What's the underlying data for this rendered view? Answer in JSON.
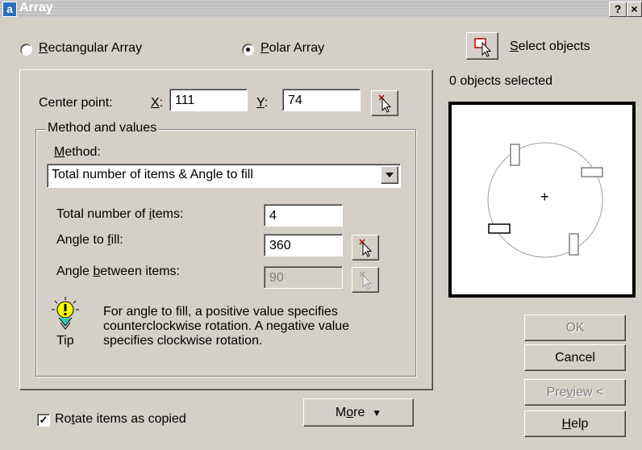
{
  "window": {
    "icon_letter": "a",
    "title": "Array",
    "help_button": "?",
    "close_button": "×"
  },
  "array_type": {
    "rectangular": {
      "label": "Rectangular Array",
      "mnemonic": "R",
      "rest": "ectangular Array",
      "selected": false
    },
    "polar": {
      "label": "Polar Array",
      "mnemonic": "P",
      "rest": "olar Array",
      "selected": true
    }
  },
  "select_objects": {
    "label": "Select objects",
    "mnemonic": "S",
    "rest": "elect objects",
    "status": "0 objects selected"
  },
  "center_point": {
    "label": "Center point:",
    "x_label_mn": "X",
    "x_label_rest": ":",
    "x_value": "111",
    "y_label_mn": "Y",
    "y_label_rest": ":",
    "y_value": "74"
  },
  "method_group": {
    "legend": "Method and values",
    "method_label_mn": "M",
    "method_label_rest": "ethod:",
    "method_value": "Total number of items & Angle to fill",
    "total_items_pre": "Total number of ",
    "total_items_mn": "i",
    "total_items_post": "tems:",
    "total_items_value": "4",
    "angle_fill_pre": "Angle to ",
    "angle_fill_mn": "f",
    "angle_fill_post": "ill:",
    "angle_fill_value": "360",
    "angle_between_pre": "Angle ",
    "angle_between_mn": "b",
    "angle_between_post": "etween items:",
    "angle_between_value": "90"
  },
  "tip": {
    "label": "Tip",
    "line1": "For angle to fill, a positive value specifies",
    "line2": "counterclockwise rotation.  A negative value",
    "line3": "specifies clockwise rotation."
  },
  "rotate_items": {
    "pre": "Ro",
    "mn": "t",
    "post": "ate items as copied",
    "checked": true
  },
  "more_button": {
    "pre": "M",
    "mn": "o",
    "post": "re",
    "arrow": "▼"
  },
  "buttons": {
    "ok": "OK",
    "cancel": "Cancel",
    "preview_pre": "Pre",
    "preview_mn": "v",
    "preview_post": "iew <",
    "help_mn": "H",
    "help_post": "elp"
  },
  "preview": {
    "center_marker": "+"
  },
  "colors": {
    "dialog_bg": "#d4d0c8",
    "title_bg": "#c4c4c4",
    "disabled_text": "#808080"
  }
}
